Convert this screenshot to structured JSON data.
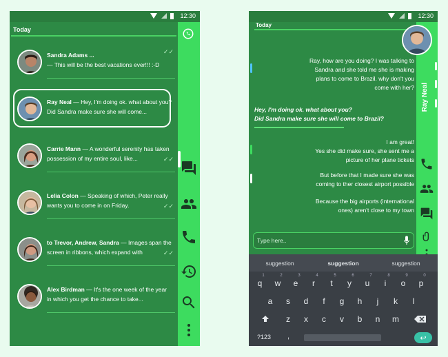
{
  "status_bar": {
    "time": "12:30"
  },
  "left": {
    "header": "Today",
    "chats": [
      {
        "name": "Sandra Adams ...",
        "message": "— This  will be the best vacations ever!!! :-D",
        "skin": "#b88468",
        "hair": "#2b1d16",
        "bg": "#7c8a80"
      },
      {
        "name": "Ray Neal",
        "message": "— Hey, I'm doing ok. what about you? Did Sandra make sure she will come...",
        "skin": "#e2b897",
        "hair": "#5a3f26",
        "bg": "#6d90b0"
      },
      {
        "name": "Carrie Mann",
        "message": "— A wonderful serenity has taken possession of my entire soul, like...",
        "skin": "#d89d80",
        "hair": "#4c2e1f",
        "bg": "#9aa59b"
      },
      {
        "name": "Lelia Colon",
        "message": "— Speaking of which, Peter really wants you to come in on Friday.",
        "skin": "#e7c0a4",
        "hair": "#7b5a3a",
        "bg": "#c6b89f"
      },
      {
        "name": "to Trevor, Andrew, Sandra",
        "message": "— Images span the screen in ribbons, which expand with",
        "skin": "#cf9a82",
        "hair": "#3a2418",
        "bg": "#8b8f8a"
      },
      {
        "name": "Alex Birdman",
        "message": "— It's the one week of the year in which you get the chance to take...",
        "skin": "#8a5a3e",
        "hair": "#1c120c",
        "bg": "#a7a7a0"
      }
    ]
  },
  "right": {
    "header": "Today",
    "contact_name": "Ray Neal",
    "messages": [
      {
        "type": "incoming",
        "lines": [
          "Ray, how are you doing? I was talking to",
          "Sandra and she told me she is making",
          "plans to come to Brazil. why don't you",
          "come with her?"
        ]
      },
      {
        "type": "outgoing",
        "lines": [
          "Hey, I'm doing ok. what about you?",
          "Did Sandra make sure she will come to Brazil?"
        ]
      },
      {
        "type": "incoming",
        "lines": [
          "I am great!",
          "Yes she did make sure, she sent me a",
          "picture of her plane tickets"
        ]
      },
      {
        "type": "incoming",
        "lines": [
          "But before that I made sure she was",
          "coming to ther closest airport possible"
        ]
      },
      {
        "type": "incoming",
        "lines": [
          "Because the big airports (international",
          "ones) aren't close to my town"
        ]
      }
    ],
    "input_placeholder": "Type here..",
    "keyboard": {
      "suggestions": [
        "suggestion",
        "suggestion",
        "suggestion"
      ],
      "row1": [
        "q",
        "w",
        "e",
        "r",
        "t",
        "y",
        "u",
        "i",
        "o",
        "p"
      ],
      "row1_digits": [
        "1",
        "2",
        "3",
        "4",
        "5",
        "6",
        "7",
        "8",
        "9",
        "0"
      ],
      "row2": [
        "a",
        "s",
        "d",
        "f",
        "g",
        "h",
        "j",
        "k",
        "l"
      ],
      "row3": [
        "z",
        "x",
        "c",
        "v",
        "b",
        "n",
        "m"
      ],
      "numbers_key": "?123",
      "comma": ","
    }
  },
  "colors": {
    "primary": "#2d8a45",
    "accent": "#3ddc5f"
  },
  "icons": [
    "whatsapp-icon",
    "chat-icon",
    "group-icon",
    "phone-icon",
    "history-icon",
    "search-icon",
    "more-icon",
    "attach-icon",
    "mic-icon",
    "shift-icon",
    "backspace-icon",
    "enter-icon"
  ]
}
